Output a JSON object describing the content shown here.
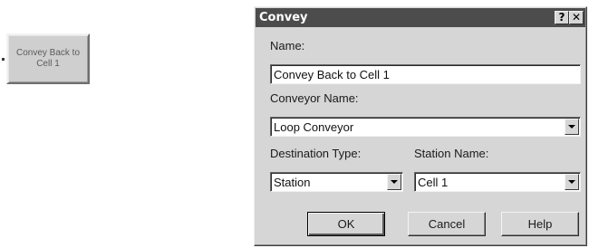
{
  "canvas": {
    "module_label": "Convey Back to Cell 1"
  },
  "dialog": {
    "title": "Convey",
    "help_button": "?",
    "close_button": "✕",
    "name": {
      "label": "Name:",
      "value": "Convey Back to Cell 1"
    },
    "conveyor_name": {
      "label": "Conveyor Name:",
      "selected": "Loop Conveyor"
    },
    "destination_type": {
      "label": "Destination Type:",
      "selected": "Station"
    },
    "station_name": {
      "label": "Station Name:",
      "selected": "Cell 1"
    },
    "buttons": {
      "ok": "OK",
      "cancel": "Cancel",
      "help": "Help"
    }
  },
  "colors": {
    "title_bar": "#4c4c4c",
    "dialog_face": "#d6d6d6",
    "module_face": "#cfcfcf"
  }
}
